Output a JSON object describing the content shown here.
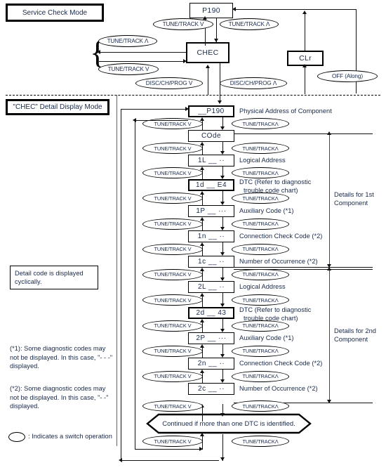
{
  "diagram": {
    "title_boxes": [
      {
        "label": "Service Check Mode"
      },
      {
        "label": "\"CHEC\" Detail Display Mode"
      }
    ],
    "top_section": {
      "states": [
        {
          "id": "p190",
          "label": "P190"
        },
        {
          "id": "chec",
          "label": "CHEC"
        },
        {
          "id": "clr",
          "label": "CLr"
        }
      ],
      "switches": [
        {
          "id": "sw-p190-down",
          "label": "TUNE/TRACK V"
        },
        {
          "id": "sw-p190-up",
          "label": "TUNE/TRACK Λ"
        },
        {
          "id": "sw-chec-up-left",
          "label": "TUNE/TRACK Λ"
        },
        {
          "id": "sw-chec-down-left",
          "label": "TUNE/TRACK V"
        },
        {
          "id": "sw-disc-down",
          "label": "DISC/CH/PROG V"
        },
        {
          "id": "sw-disc-up",
          "label": "DISC/CH/PROG Λ"
        },
        {
          "id": "sw-off-along",
          "label": "OFF  (Along)"
        }
      ]
    },
    "detail_section": {
      "rows": [
        {
          "id": "row-p190",
          "code": "__P190",
          "desc": "Physical Address of Component",
          "thick": true,
          "sw_down": "TUNE/TRACK V",
          "sw_up": "TUNE/TRACKΛ"
        },
        {
          "id": "row-code",
          "code": "COde",
          "desc": "",
          "thick": false,
          "sw_down": "TUNE/TRACK V",
          "sw_up": "TUNE/TRACKΛ"
        },
        {
          "id": "row-1l",
          "code": "1L __  ··",
          "desc": "Logical Address",
          "thick": false,
          "sw_down": "TUNE/TRACK V",
          "sw_up": "TUNE/TRACKΛ"
        },
        {
          "id": "row-1d",
          "code": "1d __ E4",
          "desc": "DTC (Refer to diagnostic trouble code chart)",
          "thick": true,
          "sw_down": "TUNE/TRACK V",
          "sw_up": "TUNE/TRACKΛ"
        },
        {
          "id": "row-1p",
          "code": "1P __  ···",
          "desc": "Auxiliary Code (*1)",
          "thick": false,
          "sw_down": "TUNE/TRACK V",
          "sw_up": "TUNE/TRACKΛ"
        },
        {
          "id": "row-1n",
          "code": "1n __  ··",
          "desc": "Connection Check Code (*2)",
          "thick": false,
          "sw_down": "TUNE/TRACK V",
          "sw_up": "TUNE/TRACKΛ"
        },
        {
          "id": "row-1c",
          "code": "1c __  ··",
          "desc": "Number of Occurrence (*2)",
          "thick": false,
          "sw_down": "TUNE/TRACK V",
          "sw_up": "TUNE/TRACKΛ"
        },
        {
          "id": "row-2l",
          "code": "2L __  ··",
          "desc": "Logical Address",
          "thick": false,
          "sw_down": "TUNE/TRACK V",
          "sw_up": "TUNE/TRACKΛ"
        },
        {
          "id": "row-2d",
          "code": "2d __ 43",
          "desc": "DTC (Refer to diagnostic trouble code chart)",
          "thick": true,
          "sw_down": "TUNE/TRACK V",
          "sw_up": "TUNE/TRACKΛ"
        },
        {
          "id": "row-2p",
          "code": "2P __  ···",
          "desc": "Auxiliary Code (*1)",
          "thick": false,
          "sw_down": "TUNE/TRACK V",
          "sw_up": "TUNE/TRACKΛ"
        },
        {
          "id": "row-2n",
          "code": "2n __  ··",
          "desc": "Connection Check Code (*2)",
          "thick": false,
          "sw_down": "TUNE/TRACK V",
          "sw_up": "TUNE/TRACKΛ"
        },
        {
          "id": "row-2c",
          "code": "2c __  ··",
          "desc": "Number of Occurrence (*2)",
          "thick": false,
          "sw_down": "TUNE/TRACK V",
          "sw_up": "TUNE/TRACKΛ"
        }
      ],
      "desc_lines": {
        "dtc_line1": "DTC (Refer to diagnostic",
        "dtc_line2": "trouble code chart)"
      },
      "continued_label": "Continued if more than one DTC is identified.",
      "bottom_switch_down": "TUNE/TRACK V",
      "bottom_switch_up": "TUNE/TRACKΛ",
      "brackets": [
        {
          "id": "bracket-1st",
          "line1": "Details for 1st",
          "line2": "Component"
        },
        {
          "id": "bracket-2nd",
          "line1": "Details for 2nd",
          "line2": "Component"
        }
      ]
    },
    "notes": {
      "cyclic": "Detail code is displayed cyclically.",
      "note1": "(*1): Some diagnostic codes may not be displayed. In this case, \"- - -\" displayed.",
      "note2": "(*2): Some diagnostic codes may not be displayed. In this case, \"- -\" displayed.",
      "legend": ": Indicates a switch operation"
    }
  }
}
